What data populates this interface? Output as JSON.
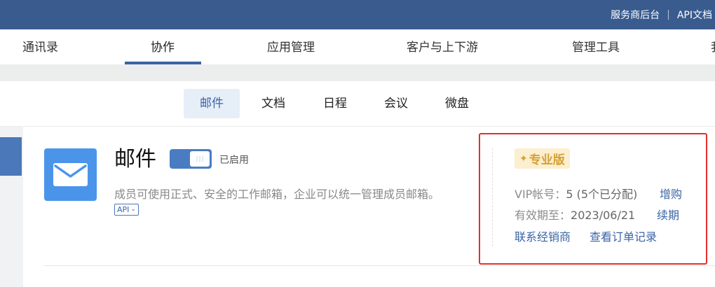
{
  "topbar": {
    "links": [
      "服务商后台",
      "API文档"
    ],
    "separator": "|"
  },
  "nav": {
    "tabs": [
      {
        "label": "通讯录"
      },
      {
        "label": "协作"
      },
      {
        "label": "应用管理"
      },
      {
        "label": "客户与上下游"
      },
      {
        "label": "管理工具"
      },
      {
        "label": "我"
      }
    ],
    "active_tab": "协作"
  },
  "subnav": {
    "items": [
      {
        "label": "邮件"
      },
      {
        "label": "文档"
      },
      {
        "label": "日程"
      },
      {
        "label": "会议"
      },
      {
        "label": "微盘"
      }
    ],
    "active_item": "邮件"
  },
  "app": {
    "title": "邮件",
    "icon": "mail-icon",
    "toggle_state": "on",
    "toggle_label": "已启用",
    "description": "成员可使用正式、安全的工作邮箱，企业可以统一管理成员邮箱。",
    "api_badge": "API",
    "api_badge_icon": "chevron-down-icon"
  },
  "subscription": {
    "edition": "专业版",
    "edition_icon": "sparkle-icon",
    "vip_label": "VIP帐号：",
    "vip_value": "5 (5个已分配)",
    "buy_link": "增购",
    "expiry_label": "有效期至：",
    "expiry_value": "2023/06/21",
    "renew_link": "续期",
    "contact_link": "联系经销商",
    "orders_link": "查看订单记录"
  },
  "colors": {
    "header_bg": "#395b8e",
    "accent": "#3b64a6",
    "app_icon_bg": "#4a95ea",
    "pro_badge_bg": "#fbefcf",
    "pro_badge_text": "#d6a034",
    "highlight_border": "#e0302e"
  }
}
